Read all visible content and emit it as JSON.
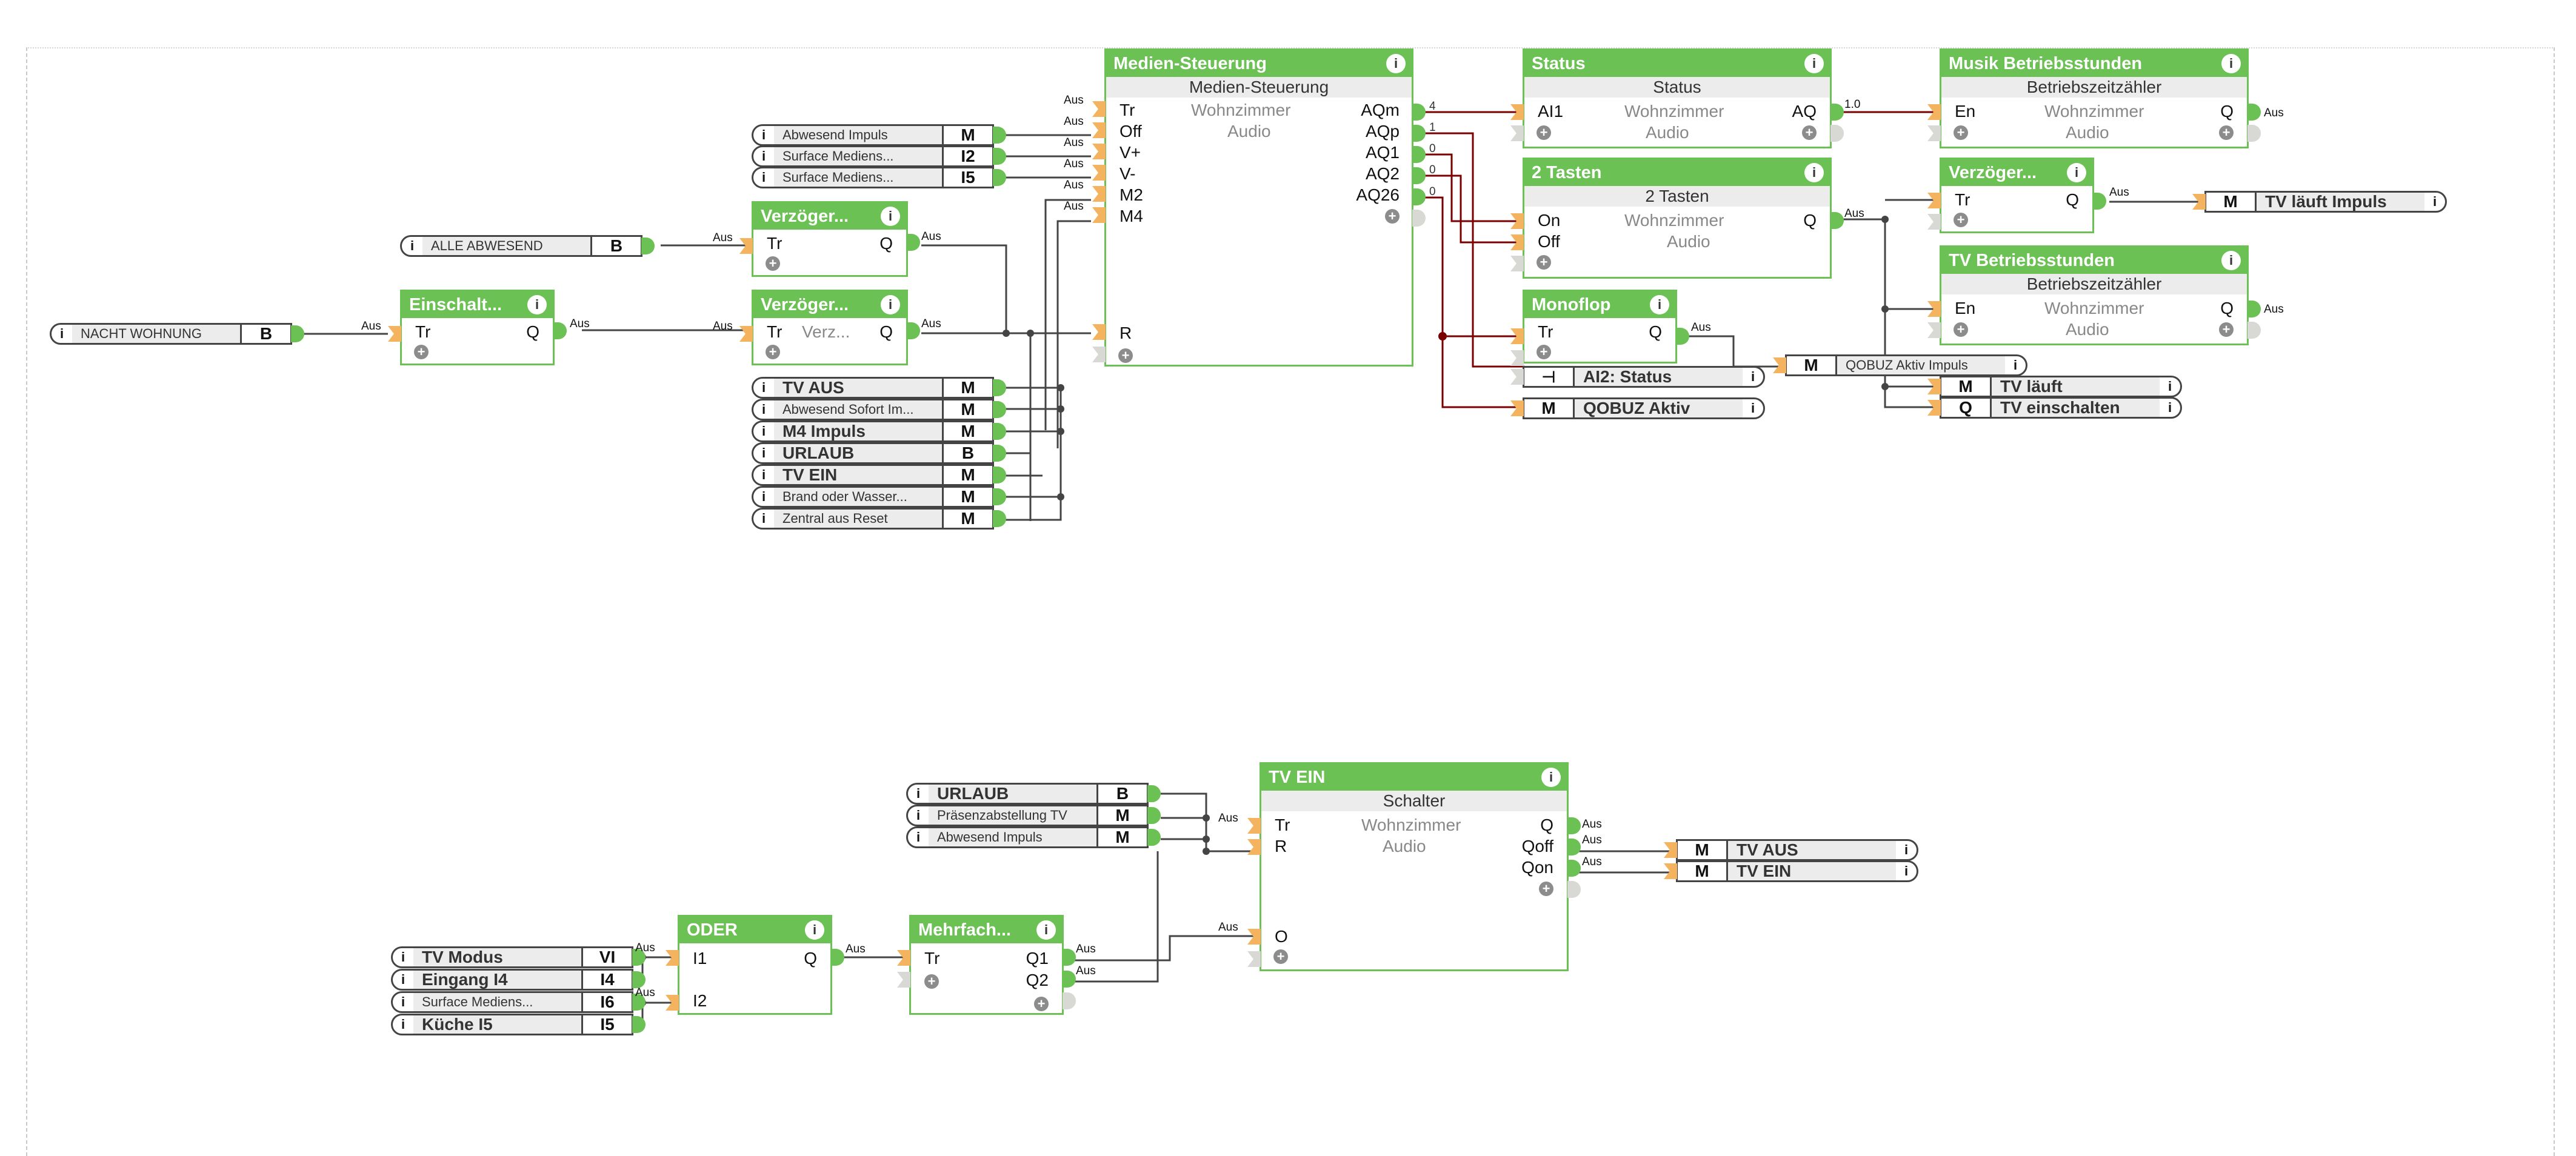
{
  "canvas": {
    "wire_color": "#444444",
    "analog_wire_color": "#7a0000",
    "block_color": "#6bc153",
    "input_pin_color": "#f4b35e"
  },
  "info_glyph": "i",
  "plus_glyph": "+",
  "wire_label": "Aus",
  "left_inputs": {
    "nacht": {
      "name": "NACHT WOHNUNG",
      "type": "B"
    },
    "alle_abwesend": {
      "name": "ALLE ABWESEND",
      "type": "B"
    },
    "abwesend_impuls": {
      "name": "Abwesend Impuls",
      "type": "M"
    },
    "surface_i2": {
      "name": "Surface Mediens...",
      "type": "I2"
    },
    "surface_i5": {
      "name": "Surface Mediens...",
      "type": "I5"
    },
    "list": [
      {
        "name": "TV AUS",
        "type": "M",
        "bold": true
      },
      {
        "name": "Abwesend Sofort Im...",
        "type": "M",
        "bold": false
      },
      {
        "name": "M4 Impuls",
        "type": "M",
        "bold": true
      },
      {
        "name": "URLAUB",
        "type": "B",
        "bold": true
      },
      {
        "name": "TV EIN",
        "type": "M",
        "bold": true
      },
      {
        "name": "Brand oder Wasser...",
        "type": "M",
        "bold": false
      },
      {
        "name": "Zentral aus Reset",
        "type": "M",
        "bold": false
      }
    ]
  },
  "blocks": {
    "einschalt": {
      "title": "Einschalt...",
      "in": "Tr",
      "out": "Q"
    },
    "verz1": {
      "title": "Verzöger...",
      "in": "Tr",
      "out": "Q"
    },
    "verz2": {
      "title": "Verzöger...",
      "in": "Tr",
      "mid": "Verz...",
      "out": "Q"
    },
    "medien": {
      "title": "Medien-Steuerung",
      "sub": "Medien-Steuerung",
      "room": "Wohnzimmer",
      "cat": "Audio",
      "inputs": [
        "Tr",
        "Off",
        "V+",
        "V-",
        "M2",
        "M4",
        "R"
      ],
      "outputs": [
        "AQm",
        "AQp",
        "AQ1",
        "AQ2",
        "AQ26"
      ],
      "output_values": [
        "4",
        "1",
        "0",
        "0",
        "0"
      ]
    },
    "status": {
      "title": "Status",
      "sub": "Status",
      "room": "Wohnzimmer",
      "cat": "Audio",
      "in": "AI1",
      "out": "AQ",
      "out_value": "1.0"
    },
    "tasten": {
      "title": "2 Tasten",
      "sub": "2 Tasten",
      "room": "Wohnzimmer",
      "cat": "Audio",
      "in1": "On",
      "in2": "Off",
      "out": "Q"
    },
    "monoflop": {
      "title": "Monoflop",
      "in": "Tr",
      "out": "Q"
    },
    "musik": {
      "title": "Musik Betriebsstunden",
      "sub": "Betriebszeitzähler",
      "room": "Wohnzimmer",
      "cat": "Audio",
      "in": "En",
      "out": "Q"
    },
    "verz3": {
      "title": "Verzöger...",
      "in": "Tr",
      "out": "Q"
    },
    "tvbetrieb": {
      "title": "TV Betriebsstunden",
      "sub": "Betriebszeitzähler",
      "room": "Wohnzimmer",
      "cat": "Audio",
      "in": "En",
      "out": "Q"
    },
    "tvein": {
      "title": "TV EIN",
      "sub": "Schalter",
      "room": "Wohnzimmer",
      "cat": "Audio",
      "in1": "Tr",
      "in2": "R",
      "in3": "O",
      "out1": "Q",
      "out2": "Qoff",
      "out3": "Qon"
    },
    "oder": {
      "title": "ODER",
      "in1": "I1",
      "in2": "I2",
      "out": "Q"
    },
    "mehrfach": {
      "title": "Mehrfach...",
      "in": "Tr",
      "out1": "Q1",
      "out2": "Q2"
    }
  },
  "outputs_refs": {
    "tv_laeuft_impuls": {
      "type": "M",
      "name": "TV läuft Impuls"
    },
    "ai2_status": {
      "icon": "input-port-icon",
      "name": "AI2: Status"
    },
    "qobuz_aktiv": {
      "type": "M",
      "name": "QOBUZ Aktiv"
    },
    "qobuz_impuls": {
      "type": "M",
      "name": "QOBUZ Aktiv Impuls"
    },
    "tv_laeuft": {
      "type": "M",
      "name": "TV läuft"
    },
    "tv_einschalten": {
      "type": "Q",
      "name": "TV einschalten"
    },
    "tv_aus": {
      "type": "M",
      "name": "TV AUS"
    },
    "tv_ein": {
      "type": "M",
      "name": "TV EIN"
    }
  },
  "bottom_inputs": {
    "top": [
      {
        "name": "URLAUB",
        "type": "B",
        "bold": true
      },
      {
        "name": "Präsenzabstellung TV",
        "type": "M",
        "bold": false
      },
      {
        "name": "Abwesend Impuls",
        "type": "M",
        "bold": false
      }
    ],
    "left": [
      {
        "name": "TV Modus",
        "type": "VI",
        "bold": true
      },
      {
        "name": "Eingang I4",
        "type": "I4",
        "bold": true
      },
      {
        "name": "Surface Mediens...",
        "type": "I6",
        "bold": false
      },
      {
        "name": "Küche I5",
        "type": "I5",
        "bold": true
      }
    ]
  }
}
